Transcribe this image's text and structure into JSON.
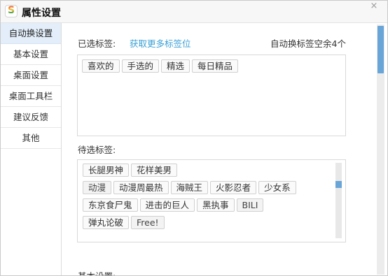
{
  "window": {
    "logo_letter": "S",
    "title": "属性设置",
    "close_glyph": "×"
  },
  "sidebar": {
    "items": [
      {
        "label": "自动换设置",
        "active": true
      },
      {
        "label": "基本设置",
        "active": false
      },
      {
        "label": "桌面设置",
        "active": false
      },
      {
        "label": "桌面工具栏",
        "active": false
      },
      {
        "label": "建议反馈",
        "active": false
      },
      {
        "label": "其他",
        "active": false
      }
    ]
  },
  "selected": {
    "label": "已选标签:",
    "get_more": "获取更多标签位",
    "auto_note": "自动换标签空余4个",
    "tags": [
      "喜欢的",
      "手选的",
      "精选",
      "每日精品"
    ]
  },
  "pending": {
    "label": "待选标签:",
    "rows": [
      [
        "长腿男神",
        "花样美男"
      ],
      [
        "动漫",
        "动漫周最热",
        "海贼王",
        "火影忍者",
        "少女系"
      ],
      [
        "东京食尸鬼",
        "进击的巨人",
        "黑执事",
        "BILI"
      ],
      [
        "弹丸论破",
        "Free!"
      ]
    ]
  },
  "basic": {
    "label": "基本设置:"
  },
  "colors": {
    "accent_link": "#3aa0d6",
    "active_nav_bg": "#e3eefa",
    "scroll_thumb": "#6aa5d8"
  }
}
